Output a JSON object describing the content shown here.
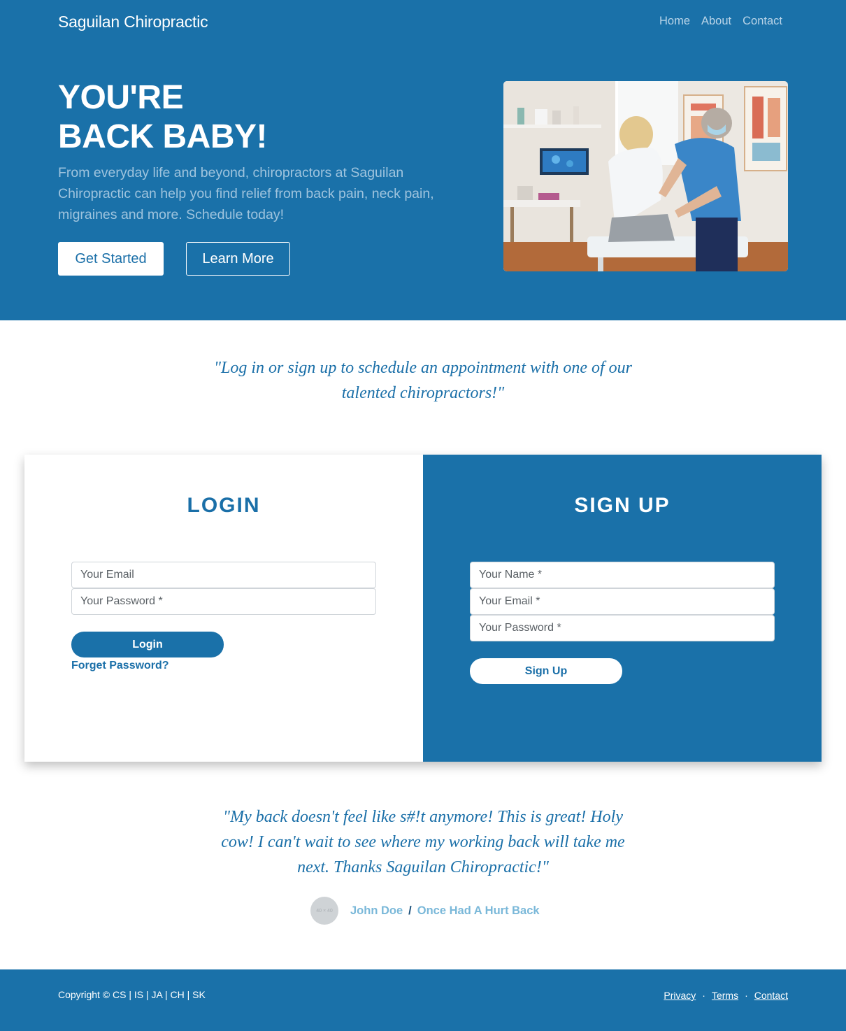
{
  "nav": {
    "brand": "Saguilan Chiropractic",
    "links": [
      "Home",
      "About",
      "Contact"
    ]
  },
  "hero": {
    "title_line1": "YOU'RE",
    "title_line2": "BACK BABY!",
    "text": "From everyday life and beyond, chiropractors at Saguilan Chiropractic can help you find relief from back pain, neck pain, migraines and more. Schedule today!",
    "get_started": "Get Started",
    "learn_more": "Learn More",
    "photo": "chiropractor-treatment-photo"
  },
  "intro_quote": "\"Log in or sign up to schedule an appointment with one of our talented chiropractors!\"",
  "login": {
    "title": "LOGIN",
    "email_placeholder": "Your Email",
    "password_placeholder": "Your Password *",
    "button": "Login",
    "forgot": "Forget Password?"
  },
  "signup": {
    "title": "SIGN UP",
    "name_placeholder": "Your Name *",
    "email_placeholder": "Your Email *",
    "password_placeholder": "Your Password *",
    "button": "Sign Up"
  },
  "testimonial": {
    "quote": "\"My back doesn't feel like s#!t anymore! This is great! Holy cow! I can't wait to see where my working back will take me next. Thanks Saguilan Chiropractic!\"",
    "avatar_text": "40 × 40",
    "name": "John Doe",
    "separator": "/",
    "role": "Once Had A Hurt Back"
  },
  "footer": {
    "copyright": "Copyright © CS | IS | JA | CH | SK",
    "links": [
      "Privacy",
      "Terms",
      "Contact"
    ],
    "separator": "·"
  },
  "colors": {
    "primary": "#1a71a9",
    "white": "#ffffff",
    "muted_text": "#9fc4de",
    "author_link": "#7ab8d9"
  }
}
